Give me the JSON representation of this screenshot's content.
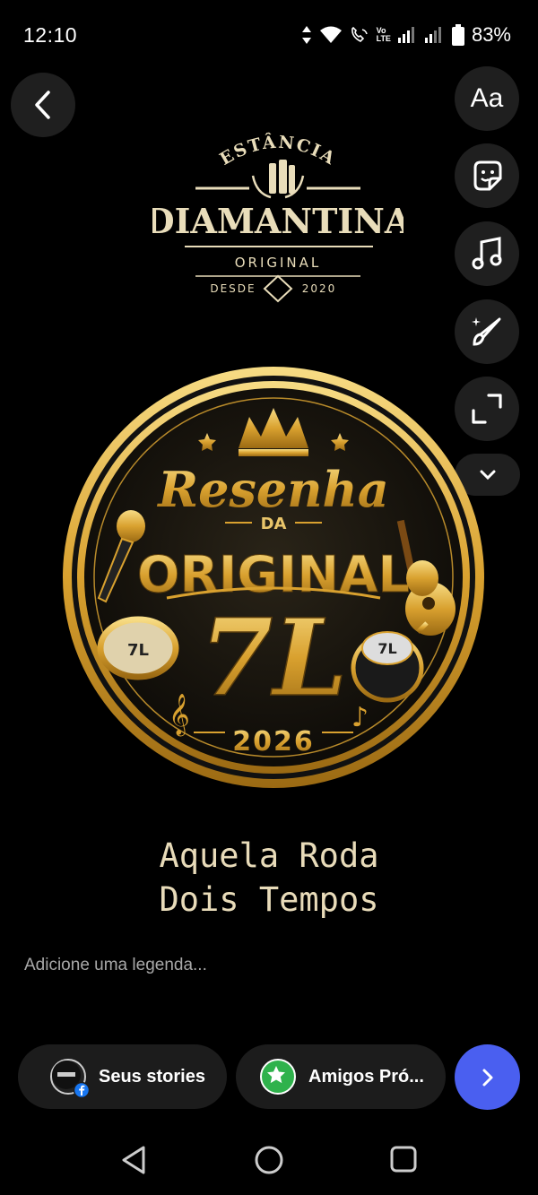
{
  "status_bar": {
    "time": "12:10",
    "battery": "83%",
    "net_label_top": "Vo",
    "net_label_bottom": "LTE"
  },
  "logo": {
    "top_text": "ESTÂNCIA",
    "brand": "DIAMANTINA",
    "subtitle": "ORIGINAL",
    "since_left": "DESDE",
    "since_right": "2020"
  },
  "badge": {
    "script_title": "Resenha",
    "da": "DA",
    "name": "ORIGINAL",
    "big": "7L",
    "year": "2026",
    "small_7l": "7L"
  },
  "tagline": {
    "line1": "Aquela Roda",
    "line2": "Dois Tempos"
  },
  "caption": {
    "placeholder": "Adicione uma legenda..."
  },
  "share": {
    "your_stories": "Seus stories",
    "close_friends": "Amigos Pró..."
  },
  "tools": [
    "text-tool",
    "sticker-tool",
    "music-tool",
    "draw-tool",
    "resize-tool",
    "more-tools"
  ],
  "colors": {
    "gold": "#d9a93a",
    "accent_blue": "#4a5ff0",
    "friends_green": "#2fb24c"
  }
}
